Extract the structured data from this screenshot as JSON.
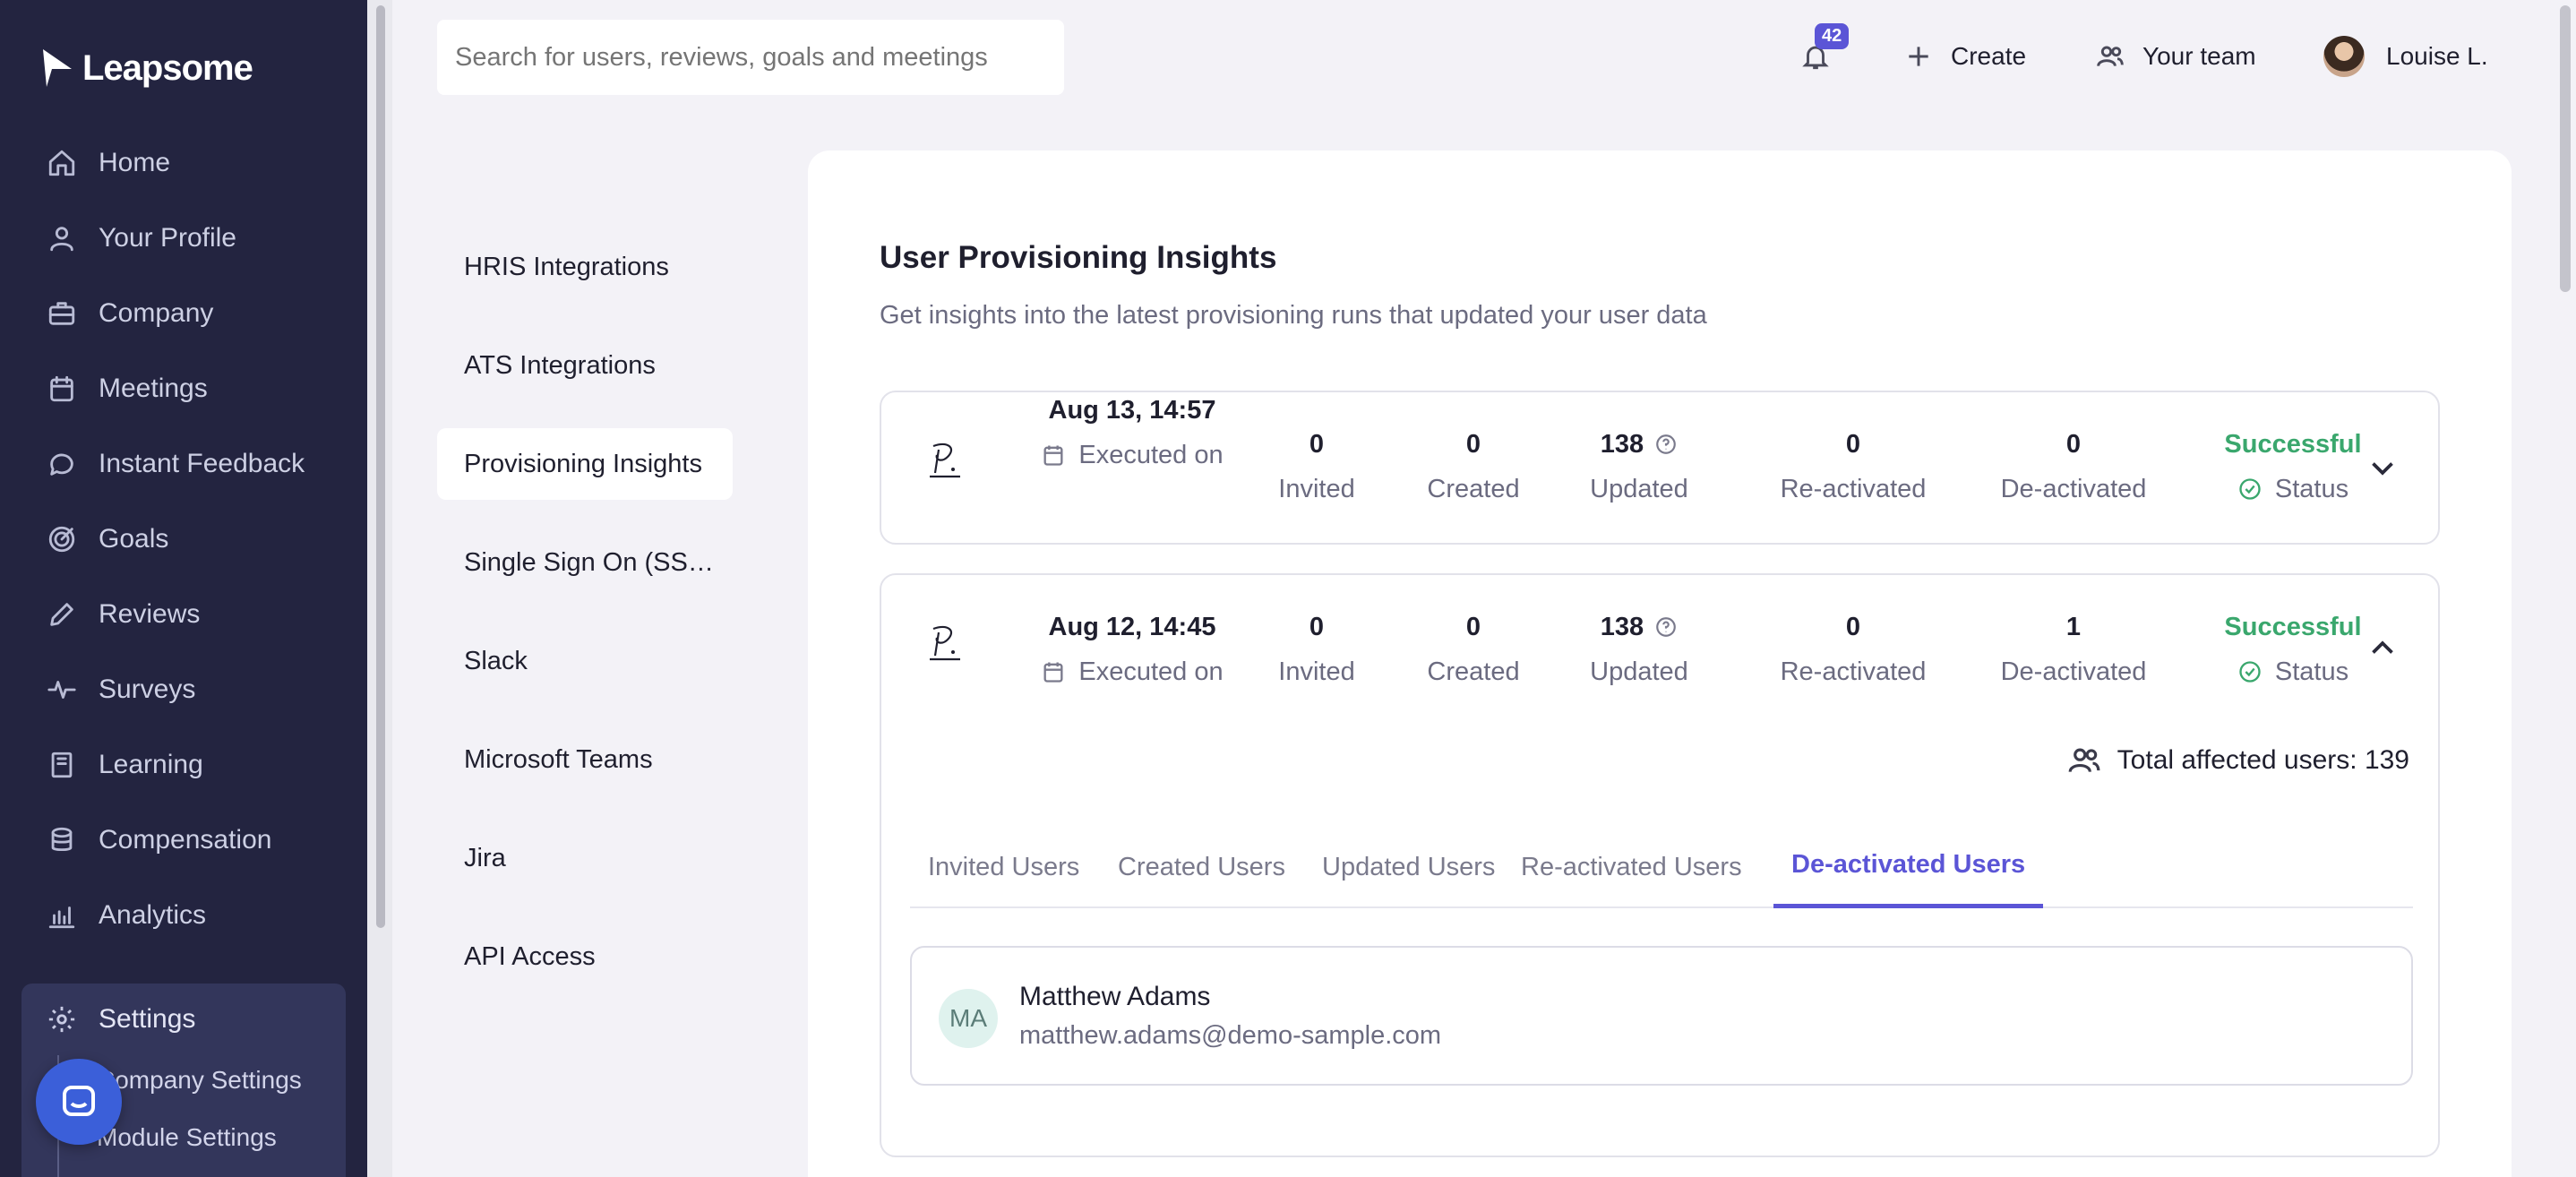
{
  "brand": {
    "name": "Leapsome"
  },
  "sidebar": {
    "items": [
      {
        "label": "Home",
        "icon": "home-icon"
      },
      {
        "label": "Your Profile",
        "icon": "user-icon"
      },
      {
        "label": "Company",
        "icon": "briefcase-icon"
      },
      {
        "label": "Meetings",
        "icon": "calendar-icon"
      },
      {
        "label": "Instant Feedback",
        "icon": "chat-icon"
      },
      {
        "label": "Goals",
        "icon": "target-icon"
      },
      {
        "label": "Reviews",
        "icon": "pencil-icon"
      },
      {
        "label": "Surveys",
        "icon": "pulse-icon"
      },
      {
        "label": "Learning",
        "icon": "book-icon"
      },
      {
        "label": "Compensation",
        "icon": "coins-icon"
      },
      {
        "label": "Analytics",
        "icon": "chart-icon"
      }
    ],
    "settings": {
      "label": "Settings",
      "sub": [
        "Company Settings",
        "Module Settings"
      ]
    }
  },
  "header": {
    "search_placeholder": "Search for users, reviews, goals and meetings",
    "notifications_count": "42",
    "create_label": "Create",
    "team_label": "Your team",
    "user_name": "Louise L."
  },
  "submenu": {
    "items": [
      "HRIS Integrations",
      "ATS Integrations",
      "Provisioning Insights",
      "Single Sign On (SS…",
      "Slack",
      "Microsoft Teams",
      "Jira",
      "API Access"
    ],
    "active_index": 2
  },
  "main": {
    "title": "User Provisioning Insights",
    "subtitle": "Get insights into the latest provisioning runs that updated your user data",
    "labels": {
      "executed_on": "Executed on",
      "invited": "Invited",
      "created": "Created",
      "updated": "Updated",
      "reactivated": "Re-activated",
      "deactivated": "De-activated",
      "status": "Status"
    },
    "runs": [
      {
        "date": "Aug 13, 14:57",
        "invited": "0",
        "created": "0",
        "updated": "138",
        "reactivated": "0",
        "deactivated": "0",
        "status": "Successful",
        "expanded": false
      },
      {
        "date": "Aug 12, 14:45",
        "invited": "0",
        "created": "0",
        "updated": "138",
        "reactivated": "0",
        "deactivated": "1",
        "status": "Successful",
        "expanded": true
      }
    ],
    "total_affected": "Total affected users: 139",
    "tabs": [
      "Invited Users",
      "Created Users",
      "Updated Users",
      "Re-activated Users",
      "De-activated Users"
    ],
    "active_tab": 4,
    "affected_user": {
      "initials": "MA",
      "name": "Matthew Adams",
      "email": "matthew.adams@demo-sample.com"
    }
  },
  "colors": {
    "sidebar_bg": "#232440",
    "accent": "#5b55d6",
    "success": "#3aa76d"
  }
}
